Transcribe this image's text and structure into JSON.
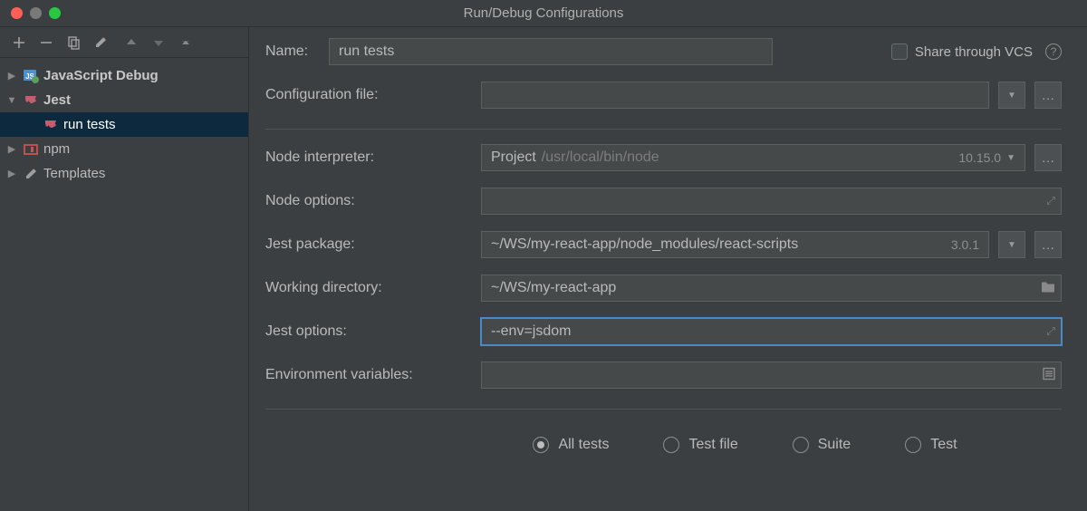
{
  "window": {
    "title": "Run/Debug Configurations"
  },
  "sidebar": {
    "items": [
      {
        "label": "JavaScript Debug",
        "icon": "js-debug",
        "expanded": false,
        "bold": true
      },
      {
        "label": "Jest",
        "icon": "jest",
        "expanded": true,
        "bold": true,
        "children": [
          {
            "label": "run tests",
            "icon": "jest",
            "selected": true
          }
        ]
      },
      {
        "label": "npm",
        "icon": "npm",
        "expanded": false,
        "bold": false
      },
      {
        "label": "Templates",
        "icon": "wrench",
        "expanded": false,
        "bold": false
      }
    ]
  },
  "form": {
    "name_label": "Name:",
    "name_value": "run tests",
    "share_label": "Share through VCS",
    "config_file_label": "Configuration file:",
    "config_file_value": "",
    "node_interpreter_label": "Node interpreter:",
    "node_interpreter_prefix": "Project",
    "node_interpreter_path": "/usr/local/bin/node",
    "node_interpreter_version": "10.15.0",
    "node_options_label": "Node options:",
    "node_options_value": "",
    "jest_package_label": "Jest package:",
    "jest_package_value": "~/WS/my-react-app/node_modules/react-scripts",
    "jest_package_version": "3.0.1",
    "working_dir_label": "Working directory:",
    "working_dir_value": "~/WS/my-react-app",
    "jest_options_label": "Jest options:",
    "jest_options_value": "--env=jsdom",
    "env_vars_label": "Environment variables:",
    "env_vars_value": "",
    "radios": {
      "all_tests": "All tests",
      "test_file": "Test file",
      "suite": "Suite",
      "test": "Test"
    }
  }
}
